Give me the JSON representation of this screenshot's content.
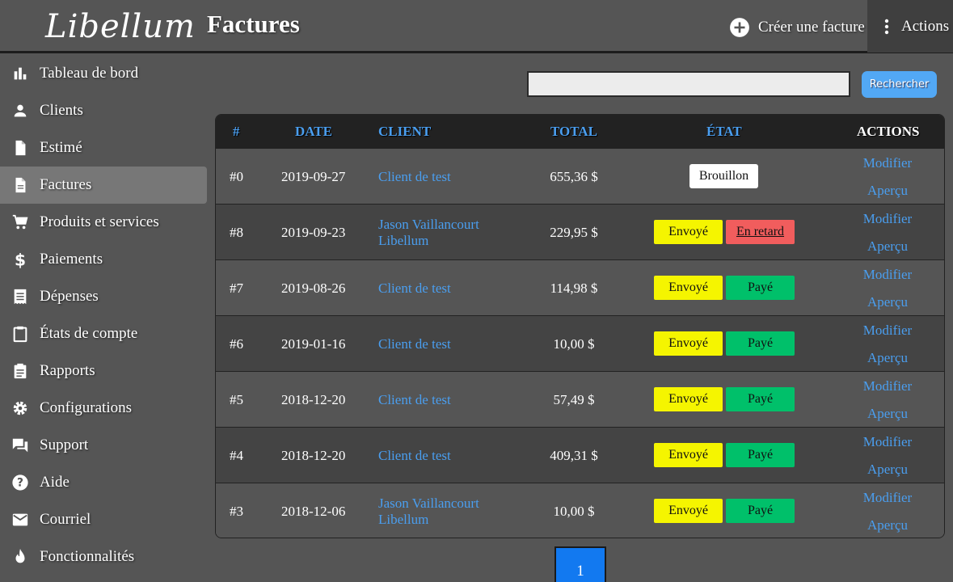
{
  "header": {
    "logo_text": "Libellum",
    "title": "Factures",
    "create_label": "Créer une facture",
    "actions_label": "Actions"
  },
  "sidebar": {
    "items": [
      {
        "label": "Tableau de bord",
        "icon": "bar-chart-icon"
      },
      {
        "label": "Clients",
        "icon": "person-icon"
      },
      {
        "label": "Estimé",
        "icon": "file-icon"
      },
      {
        "label": "Factures",
        "icon": "document-icon",
        "active": true
      },
      {
        "label": "Produits et services",
        "icon": "cart-icon"
      },
      {
        "label": "Paiements",
        "icon": "dollar-icon"
      },
      {
        "label": "Dépenses",
        "icon": "receipt-icon"
      },
      {
        "label": "États de compte",
        "icon": "clipboard-icon"
      },
      {
        "label": "Rapports",
        "icon": "assignment-icon"
      },
      {
        "label": "Configurations",
        "icon": "gear-icon"
      },
      {
        "label": "Support",
        "icon": "forum-icon"
      },
      {
        "label": "Aide",
        "icon": "help-icon"
      },
      {
        "label": "Courriel",
        "icon": "mail-icon"
      },
      {
        "label": "Fonctionnalités",
        "icon": "fire-icon"
      }
    ]
  },
  "search": {
    "value": "",
    "button_label": "Rechercher"
  },
  "table": {
    "headers": {
      "num": "#",
      "date": "Date",
      "client": "Client",
      "total": "Total",
      "status": "État",
      "actions": "Actions"
    },
    "rows": [
      {
        "num": "#0",
        "date": "2019-09-27",
        "client_line1": "Client de test",
        "client_line2": "",
        "total": "655,36 $",
        "status1": "Brouillon",
        "status2": "",
        "edit": "Modifier",
        "preview": "Aperçu"
      },
      {
        "num": "#8",
        "date": "2019-09-23",
        "client_line1": "Jason Vaillancourt",
        "client_line2": "Libellum",
        "total": "229,95 $",
        "status1": "Envoyé",
        "status2": "En retard",
        "edit": "Modifier",
        "preview": "Aperçu"
      },
      {
        "num": "#7",
        "date": "2019-08-26",
        "client_line1": "Client de test",
        "client_line2": "",
        "total": "114,98 $",
        "status1": "Envoyé",
        "status2": "Payé",
        "edit": "Modifier",
        "preview": "Aperçu"
      },
      {
        "num": "#6",
        "date": "2019-01-16",
        "client_line1": "Client de test",
        "client_line2": "",
        "total": "10,00 $",
        "status1": "Envoyé",
        "status2": "Payé",
        "edit": "Modifier",
        "preview": "Aperçu"
      },
      {
        "num": "#5",
        "date": "2018-12-20",
        "client_line1": "Client de test",
        "client_line2": "",
        "total": "57,49 $",
        "status1": "Envoyé",
        "status2": "Payé",
        "edit": "Modifier",
        "preview": "Aperçu"
      },
      {
        "num": "#4",
        "date": "2018-12-20",
        "client_line1": "Client de test",
        "client_line2": "",
        "total": "409,31 $",
        "status1": "Envoyé",
        "status2": "Payé",
        "edit": "Modifier",
        "preview": "Aperçu"
      },
      {
        "num": "#3",
        "date": "2018-12-06",
        "client_line1": "Jason Vaillancourt",
        "client_line2": "Libellum",
        "total": "10,00 $",
        "status1": "Envoyé",
        "status2": "Payé",
        "edit": "Modifier",
        "preview": "Aperçu"
      }
    ]
  },
  "pagination": {
    "current_page": "1"
  },
  "colors": {
    "accent": "#4a9eef",
    "sent": "#f5f500",
    "paid": "#00c06a",
    "late": "#f15d5d",
    "page_active": "#1279f0"
  }
}
